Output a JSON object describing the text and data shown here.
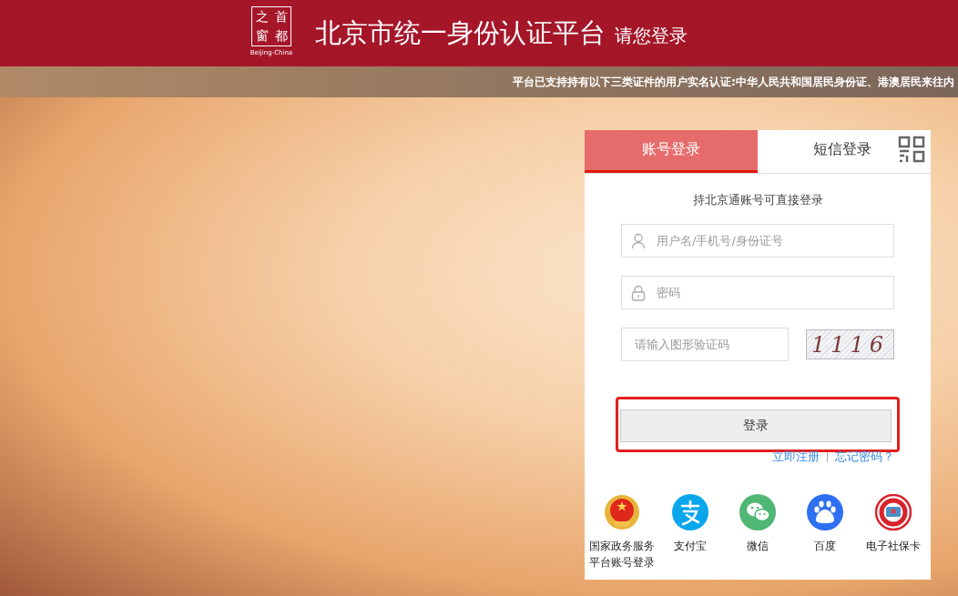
{
  "header": {
    "logo": {
      "chars": [
        "之",
        "首",
        "窗",
        "都"
      ],
      "caption": "Beijing-China"
    },
    "title": "北京市统一身份认证平台",
    "subtitle": "请您登录"
  },
  "notice": "平台已支持持有以下三类证件的用户实名认证:中华人民共和国居民身份证、港澳居民来往内",
  "login": {
    "tabs": [
      {
        "label": "账号登录",
        "selected": true
      },
      {
        "label": "短信登录",
        "selected": false
      }
    ],
    "hint": "持北京通账号可直接登录",
    "fields": [
      {
        "kind": "user",
        "placeholder": "用户名/手机号/身份证号"
      },
      {
        "kind": "password",
        "placeholder": "密码"
      }
    ],
    "captcha": {
      "placeholder": "请输入图形验证码",
      "code": "1116"
    },
    "submit": {
      "label": "登录",
      "highlighted": true
    },
    "links": [
      "立即注册",
      "忘记密码？"
    ],
    "providers": [
      {
        "kind": "gov",
        "label": "国家政务服务平台账号登录"
      },
      {
        "kind": "alipay",
        "label": "支付宝"
      },
      {
        "kind": "wechat",
        "label": "微信"
      },
      {
        "kind": "baidu",
        "label": "百度"
      },
      {
        "kind": "social",
        "label": "电子社保卡"
      }
    ]
  }
}
